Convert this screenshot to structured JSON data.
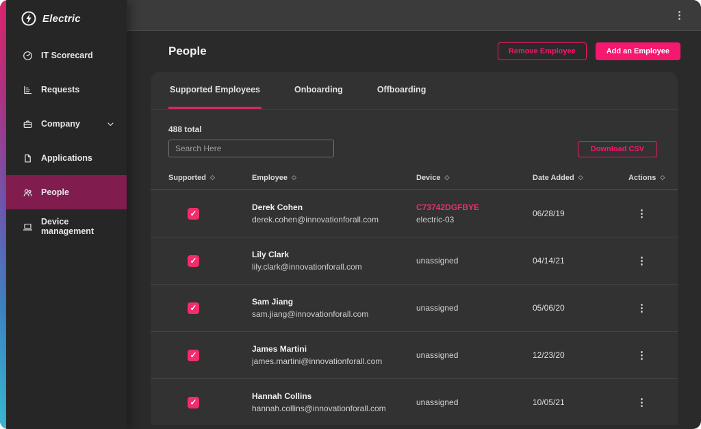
{
  "colors": {
    "accent_pink": "#f6176e",
    "tab_underline": "#e22560",
    "checkbox_pink": "#f22d6b",
    "device_link_pink": "#e8336d",
    "active_nav_bg": "#801c4e"
  },
  "topbar": {
    "menu_icon": "kebab-menu"
  },
  "sidebar": {
    "brand": "Electric",
    "items": [
      {
        "label": "IT Scorecard",
        "icon": "gauge-icon",
        "active": false,
        "expandable": false
      },
      {
        "label": "Requests",
        "icon": "chart-icon",
        "active": false,
        "expandable": false
      },
      {
        "label": "Company",
        "icon": "briefcase-icon",
        "active": false,
        "expandable": true
      },
      {
        "label": "Applications",
        "icon": "document-icon",
        "active": false,
        "expandable": false
      },
      {
        "label": "People",
        "icon": "people-icon",
        "active": true,
        "expandable": false
      },
      {
        "label": "Device management",
        "icon": "laptop-icon",
        "active": false,
        "expandable": false
      }
    ]
  },
  "header": {
    "title": "People",
    "remove_label": "Remove Employee",
    "add_label": "Add an Employee"
  },
  "tabs": [
    {
      "label": "Supported Employees",
      "active": true
    },
    {
      "label": "Onboarding",
      "active": false
    },
    {
      "label": "Offboarding",
      "active": false
    }
  ],
  "toolbar": {
    "total": "488 total",
    "search_placeholder": "Search Here",
    "download_label": "Download CSV"
  },
  "table": {
    "columns": [
      "Supported",
      "Employee",
      "Device",
      "Date Added",
      "Actions"
    ],
    "rows": [
      {
        "supported": true,
        "name": "Derek Cohen",
        "email": "derek.cohen@innovationforall.com",
        "device_id": "C73742DGFBYE",
        "device_name": "electric-03",
        "date_added": "06/28/19"
      },
      {
        "supported": true,
        "name": "Lily Clark",
        "email": "lily.clark@innovationforall.com",
        "device": "unassigned",
        "date_added": "04/14/21"
      },
      {
        "supported": true,
        "name": "Sam Jiang",
        "email": "sam.jiang@innovationforall.com",
        "device": "unassigned",
        "date_added": "05/06/20"
      },
      {
        "supported": true,
        "name": "James Martini",
        "email": "james.martini@innovationforall.com",
        "device": "unassigned",
        "date_added": "12/23/20"
      },
      {
        "supported": true,
        "name": "Hannah Collins",
        "email": "hannah.collins@innovationforall.com",
        "device": "unassigned",
        "date_added": "10/05/21"
      }
    ]
  }
}
